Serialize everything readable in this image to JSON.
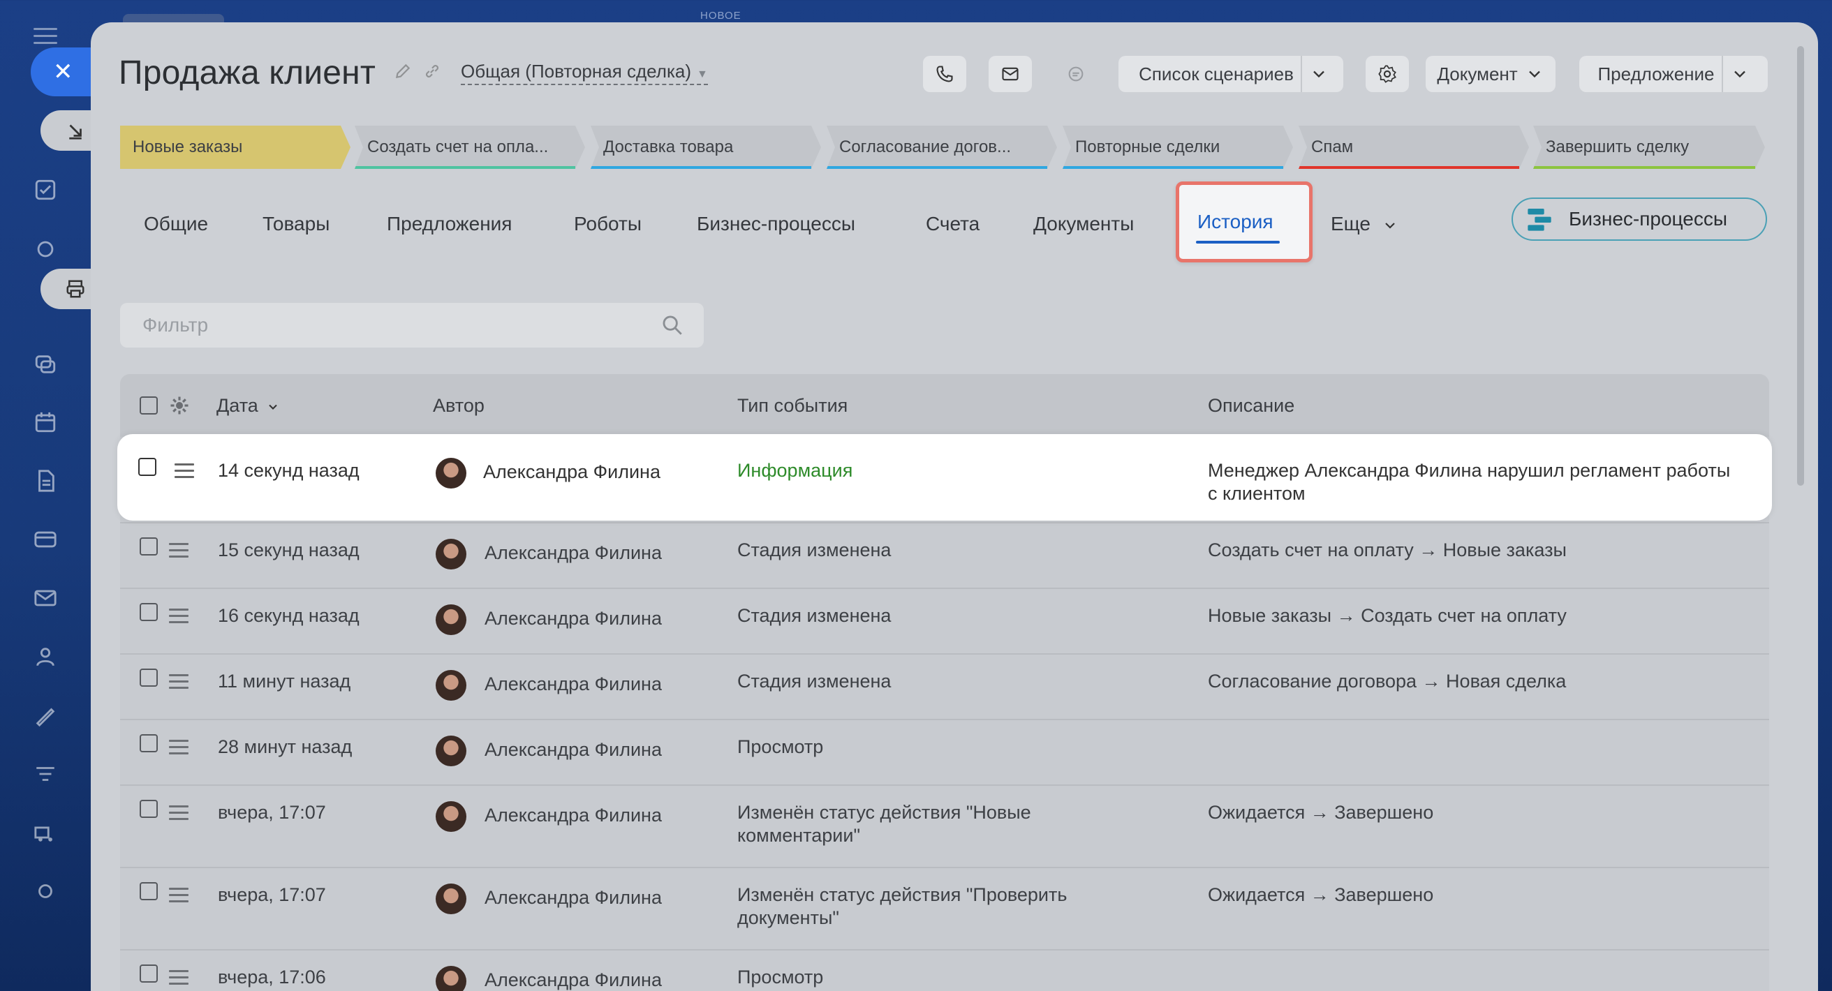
{
  "top_label": "НОВОЕ",
  "deal": {
    "title": "Продажа клиент",
    "category": "Общая (Повторная сделка)"
  },
  "header_buttons": {
    "scenarios": "Список сценариев",
    "document": "Документ",
    "offer": "Предложение"
  },
  "stages": [
    {
      "label": "Новые заказы",
      "color": "#d6c56f"
    },
    {
      "label": "Создать счет на опла...",
      "color": "#4fc3a1"
    },
    {
      "label": "Доставка товара",
      "color": "#2fa7e0"
    },
    {
      "label": "Согласование догов...",
      "color": "#2fa7e0"
    },
    {
      "label": "Повторные сделки",
      "color": "#2fa7e0"
    },
    {
      "label": "Спам",
      "color": "#e0352b"
    },
    {
      "label": "Завершить сделку",
      "color": "#8cc43f"
    }
  ],
  "tabs": [
    "Общие",
    "Товары",
    "Предложения",
    "Роботы",
    "Бизнес-процессы",
    "Счета",
    "Документы",
    "История",
    "Еще"
  ],
  "active_tab": "История",
  "bp_button": "Бизнес-процессы",
  "filter": {
    "placeholder": "Фильтр"
  },
  "table": {
    "columns": {
      "date": "Дата",
      "author": "Автор",
      "type": "Тип события",
      "description": "Описание"
    },
    "rows": [
      {
        "date": "14 секунд назад",
        "author": "Александра Филина",
        "type": "Информация",
        "description": "Менеджер Александра Филина нарушил регламент работы с клиентом"
      },
      {
        "date": "15 секунд назад",
        "author": "Александра Филина",
        "type": "Стадия изменена",
        "description": "Создать счет на оплату → Новые заказы"
      },
      {
        "date": "16 секунд назад",
        "author": "Александра Филина",
        "type": "Стадия изменена",
        "description": "Новые заказы → Создать счет на оплату"
      },
      {
        "date": "11 минут назад",
        "author": "Александра Филина",
        "type": "Стадия изменена",
        "description": "Согласование договора → Новая сделка"
      },
      {
        "date": "28 минут назад",
        "author": "Александра Филина",
        "type": "Просмотр",
        "description": ""
      },
      {
        "date": "вчера, 17:07",
        "author": "Александра Филина",
        "type": "Изменён статус действия \"Новые комментарии\"",
        "description": "Ожидается → Завершено"
      },
      {
        "date": "вчера, 17:07",
        "author": "Александра Филина",
        "type": "Изменён статус действия \"Проверить документы\"",
        "description": "Ожидается → Завершено"
      },
      {
        "date": "вчера, 17:06",
        "author": "Александра Филина",
        "type": "Просмотр",
        "description": ""
      }
    ]
  },
  "colors": {
    "accent": "#1b5fc4",
    "highlight_border": "#e8746a",
    "info_event": "#2e8b2a",
    "close_button": "#2f6fe4"
  }
}
